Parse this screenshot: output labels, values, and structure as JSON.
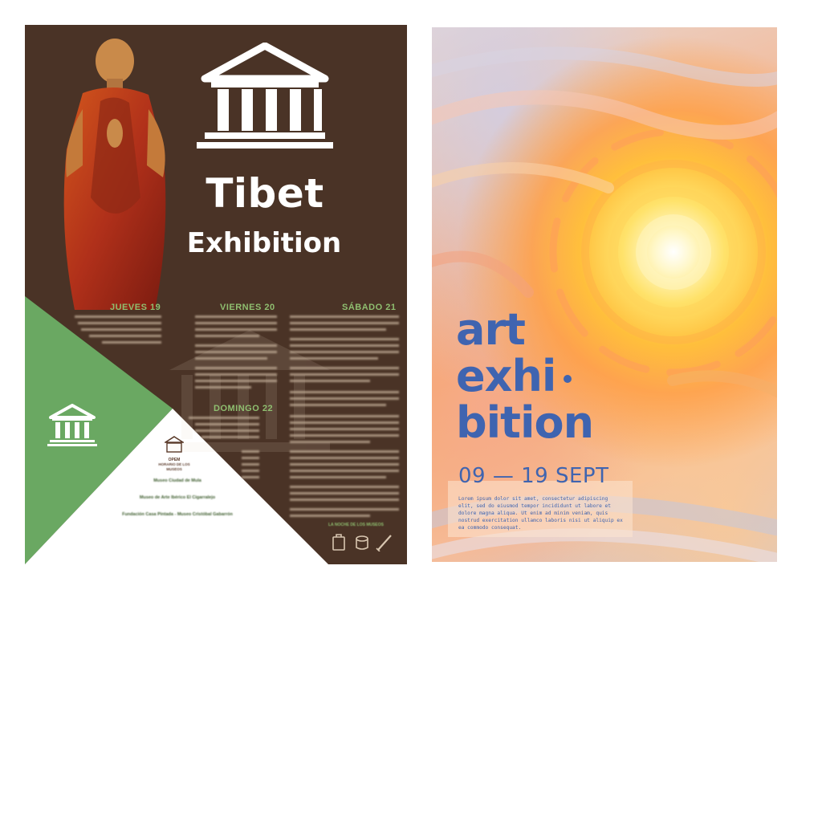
{
  "poster_tibet": {
    "title": "Tibet",
    "subtitle": "Exhibition",
    "colors": {
      "background": "#4a3326",
      "green": "#6aa862",
      "white": "#ffffff",
      "accent_text": "#8fbf70"
    },
    "days": [
      {
        "heading": "JUEVES 19"
      },
      {
        "heading": "VIERNES 20"
      },
      {
        "heading": "SÁBADO 21"
      },
      {
        "heading": "DOMINGO 22"
      }
    ],
    "opem_label": "OPEM",
    "horario": "HORARIO DE LOS MUSEOS",
    "museums": [
      {
        "name": "Museo Ciudad de Mula"
      },
      {
        "name": "Museo de Arte Ibérico El Cigarralejo"
      },
      {
        "name": "Fundación Casa Pintada - Museo Cristóbal Gabarrón"
      }
    ],
    "footer": "LA NOCHE DE LOS MUSEOS",
    "icons": [
      "museum-icon",
      "monk-image",
      "paint-bucket-icon",
      "brush-icon",
      "jar-icon"
    ]
  },
  "poster_art": {
    "title_lines": [
      "art",
      "exhi",
      "bition"
    ],
    "dates": "09 — 19 SEPT",
    "body_text": "Lorem ipsum dolor sit amet, consectetur adipiscing elit, sed do eiusmod tempor incididunt ut labore et dolore magna aliqua. Ut enim ad minim veniam, quis nostrud exercitation ullamco laboris nisi ut aliquip ex ea commodo consequat.",
    "colors": {
      "title": "#3f64b0",
      "sun": "#fff3a8",
      "orange": "#f8a762"
    }
  }
}
